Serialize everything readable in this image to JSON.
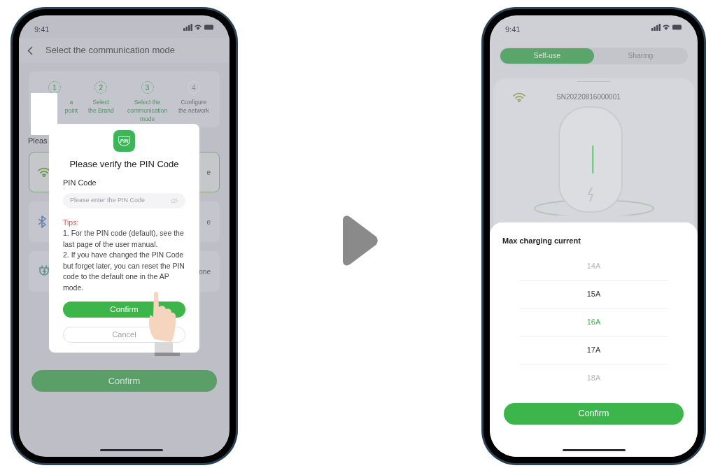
{
  "pin_screen": {
    "time": "9:41",
    "title": "Select the communication mode",
    "steps": [
      {
        "number": "1",
        "label": "a\npoint",
        "active": true
      },
      {
        "number": "2",
        "label": "Select\nthe Brand",
        "active": true
      },
      {
        "number": "3",
        "label": "Select the\ncommunication\nmode",
        "active": true
      },
      {
        "number": "4",
        "label": "Configure\nthe network",
        "active": false
      }
    ],
    "prompt": "Pleas",
    "options": [
      {
        "kind": "wifi",
        "selected": true,
        "text": "e"
      },
      {
        "kind": "bluetooth",
        "selected": false,
        "text": "e"
      },
      {
        "kind": "plug",
        "selected": false,
        "text": "one"
      }
    ],
    "confirm": "Confirm",
    "dialog": {
      "icon_text": "PIN",
      "title": "Please verify the PIN Code",
      "field_label": "PIN Code",
      "placeholder": "Please enter the PIN Code",
      "tips_title": "Tips:",
      "tips": [
        "1. For the PIN code (default), see the last page of the user manual.",
        "2. If you have changed the PIN Code but forget later, you can reset the PIN code to the default one in the AP mode."
      ],
      "confirm": "Confirm",
      "cancel": "Cancel"
    }
  },
  "charging_screen": {
    "time": "9:41",
    "tabs": [
      {
        "label": "Self-use",
        "selected": true
      },
      {
        "label": "Sharing",
        "selected": false
      }
    ],
    "serial": "SN20220816000001",
    "sheet": {
      "title": "Max charging current",
      "options": [
        {
          "label": "14A",
          "selected": false
        },
        {
          "label": "15A",
          "selected": false
        },
        {
          "label": "16A",
          "selected": true
        },
        {
          "label": "17A",
          "selected": false
        },
        {
          "label": "18A",
          "selected": false
        }
      ],
      "confirm": "Confirm"
    }
  }
}
